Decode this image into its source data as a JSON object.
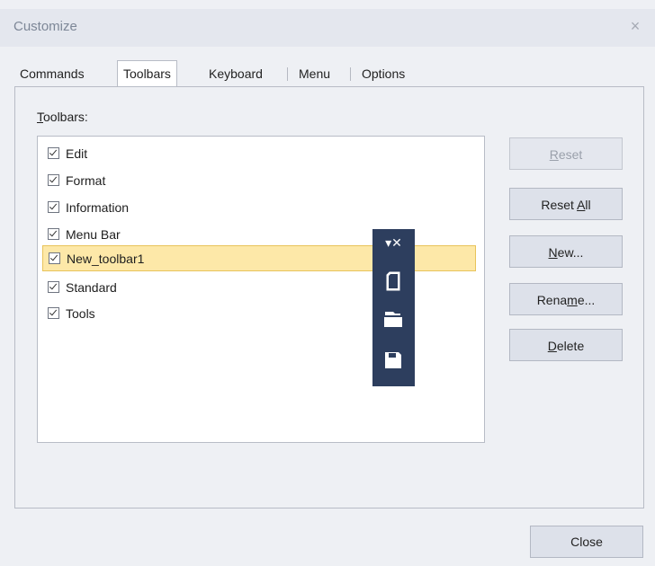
{
  "window": {
    "title": "Customize",
    "close_glyph": "×"
  },
  "tabs": [
    {
      "label": "Commands"
    },
    {
      "label": "Toolbars"
    },
    {
      "label": "Keyboard"
    },
    {
      "label": "Menu"
    },
    {
      "label": "Options"
    }
  ],
  "active_tab": "Toolbars",
  "toolbars_section": {
    "label_underlined": "T",
    "label_rest": "oolbars:",
    "items": [
      {
        "label": "Edit",
        "checked": true
      },
      {
        "label": "Format",
        "checked": true
      },
      {
        "label": "Information",
        "checked": true
      },
      {
        "label": "Menu Bar",
        "checked": true
      },
      {
        "label": "New_toolbar1",
        "checked": true,
        "selected": true
      },
      {
        "label": "Standard",
        "checked": true
      },
      {
        "label": "Tools",
        "checked": true
      }
    ]
  },
  "buttons": {
    "reset": {
      "pre": "",
      "underlined": "R",
      "post": "eset",
      "enabled": false
    },
    "reset_all": {
      "pre": "Reset ",
      "underlined": "A",
      "post": "ll",
      "enabled": true
    },
    "new": {
      "pre": "",
      "underlined": "N",
      "post": "ew...",
      "enabled": true
    },
    "rename": {
      "pre": "Rena",
      "underlined": "m",
      "post": "e...",
      "enabled": true
    },
    "delete": {
      "pre": "",
      "underlined": "D",
      "post": "elete",
      "enabled": true
    }
  },
  "floating_toolbar": {
    "header_glyph": "▾✕",
    "icons": [
      "new-document-icon",
      "open-folder-icon",
      "save-icon"
    ]
  },
  "footer": {
    "close_label": "Close"
  },
  "colors": {
    "dialog_bg": "#eef0f4",
    "selection_bg": "#fde8a8",
    "selection_border": "#e8c35a",
    "floating_toolbar_bg": "#2d3e5e"
  }
}
